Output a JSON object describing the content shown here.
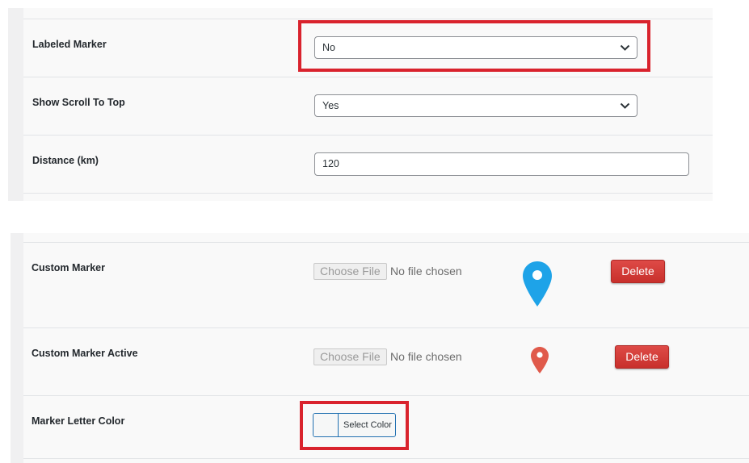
{
  "colors": {
    "highlight": "#d9232d",
    "marker_blue": "#1ea3e8",
    "marker_red": "#e05a4b",
    "delete_button": "#d23a36"
  },
  "top_panel": {
    "rows": [
      {
        "label": "Labeled Marker",
        "value": "No",
        "control": "select"
      },
      {
        "label": "Show Scroll To Top",
        "value": "Yes",
        "control": "select"
      },
      {
        "label": "Distance (km)",
        "value": "120",
        "control": "text"
      }
    ]
  },
  "bottom_panel": {
    "custom_marker": {
      "label": "Custom Marker",
      "choose_file": "Choose File",
      "file_status": "No file chosen",
      "preview_icon": "map-pin-blue",
      "delete": "Delete"
    },
    "custom_marker_active": {
      "label": "Custom Marker Active",
      "choose_file": "Choose File",
      "file_status": "No file chosen",
      "preview_icon": "map-pin-red",
      "delete": "Delete"
    },
    "marker_letter_color": {
      "label": "Marker Letter Color",
      "select_color": "Select Color"
    }
  }
}
